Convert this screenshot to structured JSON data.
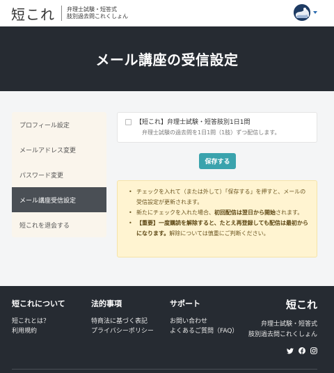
{
  "header": {
    "logo": "短これ",
    "logo_sub_line1": "弁理士試験・短答式",
    "logo_sub_line2": "肢別過去問これくしょん"
  },
  "hero": {
    "title": "メール講座の受信設定"
  },
  "sidebar": {
    "items": [
      {
        "label": "プロフィール設定",
        "active": false
      },
      {
        "label": "メールアドレス変更",
        "active": false
      },
      {
        "label": "パスワード変更",
        "active": false
      },
      {
        "label": "メール講座受信設定",
        "active": true
      },
      {
        "label": "短これを退会する",
        "active": false
      }
    ]
  },
  "subscription": {
    "title": "【短これ】弁理士試験・短答肢別1日1問",
    "description": "弁理士試験の過去問を1日1問（1肢）ずつ配信します。",
    "checked": false
  },
  "save_button": {
    "label": "保存する"
  },
  "notice": {
    "item1": "チェックを入れて（または外して）「保存する」を押すと、メールの受信設定が更新されます。",
    "item2_pre": "新たにチェックを入れた場合、",
    "item2_bold": "初回配信は翌日から開始",
    "item2_post": "されます。",
    "item3_bold": "【重要】一度購読を解除すると、たとえ再登録しても配信は最初からになります。",
    "item3_post": "解除については慎重にご判断ください。"
  },
  "footer": {
    "col1": {
      "heading": "短これについて",
      "links": [
        "短これとは？",
        "利用規約"
      ]
    },
    "col2": {
      "heading": "法的事項",
      "links": [
        "特商法に基づく表記",
        "プライバシーポリシー"
      ]
    },
    "col3": {
      "heading": "サポート",
      "links": [
        "お問い合わせ",
        "よくあるご質問（FAQ）"
      ]
    },
    "brand": "短これ",
    "brand_sub1": "弁理士試験・短答式",
    "brand_sub2": "肢別過去問これくしょん",
    "social_icons": [
      "twitter-icon",
      "facebook-icon",
      "instagram-icon"
    ]
  },
  "colors": {
    "accent": "#3aa3ad",
    "dark": "#262b32",
    "notice_bg": "#fff4d1",
    "sidebar_bg": "#faf5ec",
    "sidebar_active": "#4a4f55"
  }
}
